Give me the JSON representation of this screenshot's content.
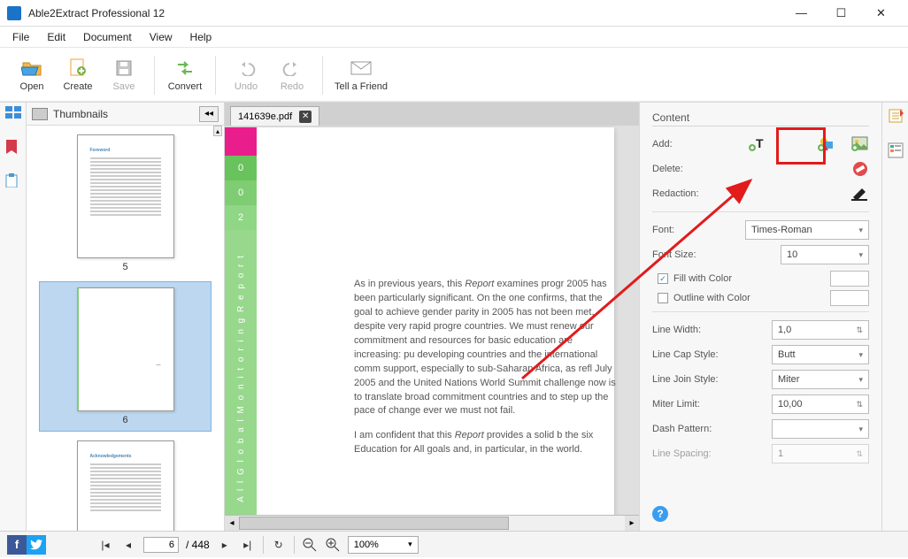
{
  "window": {
    "title": "Able2Extract Professional 12"
  },
  "menu": {
    "items": [
      "File",
      "Edit",
      "Document",
      "View",
      "Help"
    ]
  },
  "toolbar": {
    "open": "Open",
    "create": "Create",
    "save": "Save",
    "convert": "Convert",
    "undo": "Undo",
    "redo": "Redo",
    "tell": "Tell a Friend"
  },
  "thumbs": {
    "title": "Thumbnails",
    "pages": [
      {
        "num": "5",
        "title": "Foreword"
      },
      {
        "num": "6",
        "title": ""
      },
      {
        "num": "7",
        "title": "Acknowledgements"
      }
    ],
    "selected": 1
  },
  "doc": {
    "tab": "141639e.pdf",
    "spine": {
      "n1": "0",
      "n2": "0",
      "n3": "2",
      "label": "A l l  G l o b a l  M o n i t o r i n g  R e p o r t"
    },
    "para1_a": "As in previous years, this ",
    "para1_r": "Report",
    "para1_b": " examines progr 2005 has been particularly significant. On the one confirms, that the goal to achieve gender parity in 2005 has not been met, despite very rapid progre countries. We must renew our commitment and resources for basic education are increasing: pu developing countries and the international comm support, especially to sub-Saharan Africa, as refl July 2005 and the United Nations World Summit challenge now is to translate broad commitment countries and to step up the pace of change ever we must not fail.",
    "para2_a": "I am confident that this ",
    "para2_r": "Report",
    "para2_b": " provides a solid b the six Education for All goals and, in particular, in the world."
  },
  "content": {
    "section": "Content",
    "add": "Add:",
    "delete": "Delete:",
    "redaction": "Redaction:",
    "font": "Font:",
    "font_val": "Times-Roman",
    "fontsize": "Font Size:",
    "fontsize_val": "10",
    "fill": "Fill with Color",
    "outline": "Outline with Color",
    "linewidth": "Line Width:",
    "linewidth_val": "1,0",
    "cap": "Line Cap Style:",
    "cap_val": "Butt",
    "join": "Line Join Style:",
    "join_val": "Miter",
    "miter": "Miter Limit:",
    "miter_val": "10,00",
    "dash": "Dash Pattern:",
    "linespacing": "Line Spacing:",
    "linespacing_val": "1"
  },
  "bottom": {
    "page_current": "6",
    "page_total": "/ 448",
    "zoom": "100%"
  }
}
